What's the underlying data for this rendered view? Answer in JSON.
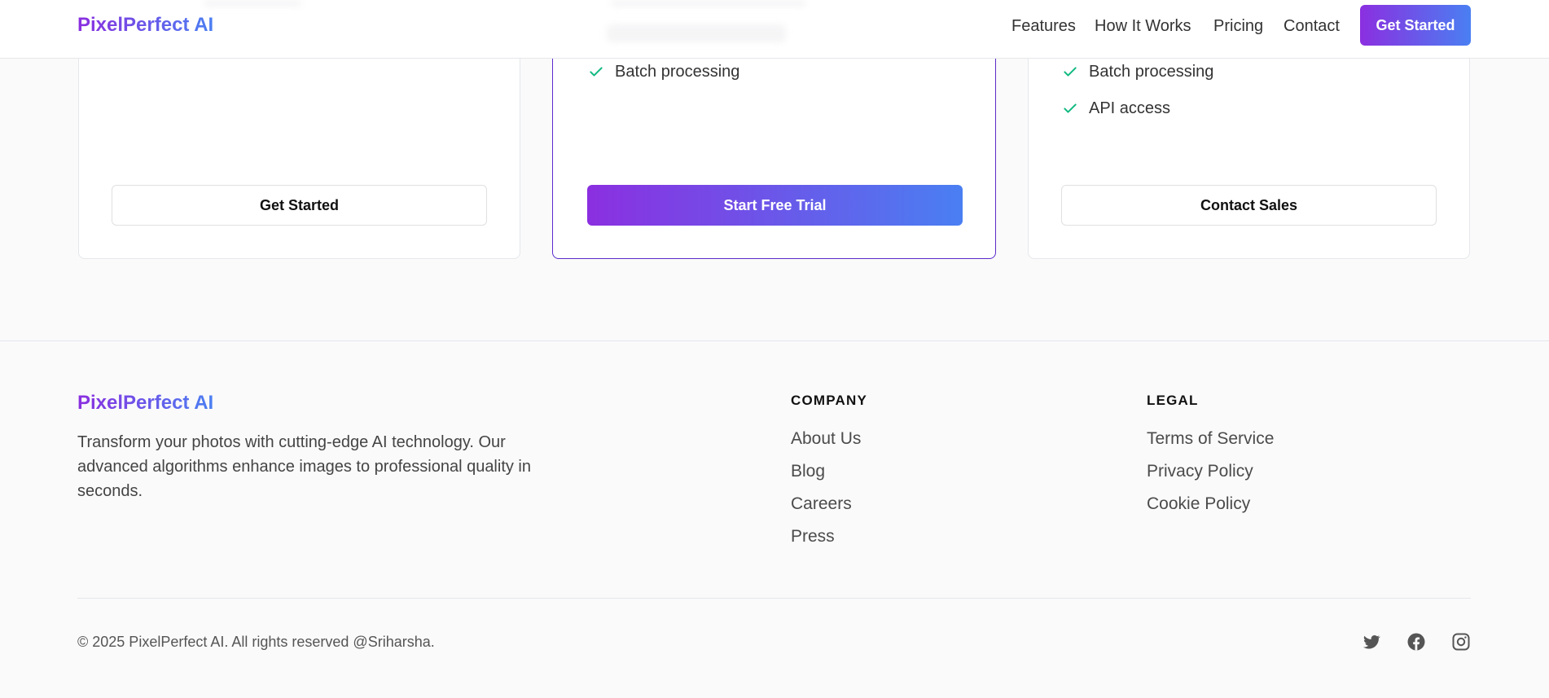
{
  "header": {
    "logo": "PixelPerfect AI",
    "nav": [
      "Features",
      "How It Works",
      "Pricing",
      "Contact"
    ],
    "cta": "Get Started"
  },
  "pricing": {
    "cards": [
      {
        "features": [],
        "button": "Get Started"
      },
      {
        "features": [
          "Batch processing"
        ],
        "button": "Start Free Trial"
      },
      {
        "features": [
          "Batch processing",
          "API access"
        ],
        "button": "Contact Sales"
      }
    ]
  },
  "footer": {
    "brand": "PixelPerfect AI",
    "description": "Transform your photos with cutting-edge AI technology. Our advanced algorithms enhance images to professional quality in seconds.",
    "company": {
      "heading": "COMPANY",
      "links": [
        "About Us",
        "Blog",
        "Careers",
        "Press"
      ]
    },
    "legal": {
      "heading": "LEGAL",
      "links": [
        "Terms of Service",
        "Privacy Policy",
        "Cookie Policy"
      ]
    },
    "copyright": "© 2025 PixelPerfect AI. All rights reserved @Sriharsha.",
    "social_icons": [
      "twitter-icon",
      "facebook-icon",
      "instagram-icon"
    ]
  },
  "colors": {
    "brand_gradient_start": "#8b2fe0",
    "brand_gradient_end": "#4a7ff2",
    "check": "#10b981",
    "featured_border": "#5b2bcc"
  }
}
